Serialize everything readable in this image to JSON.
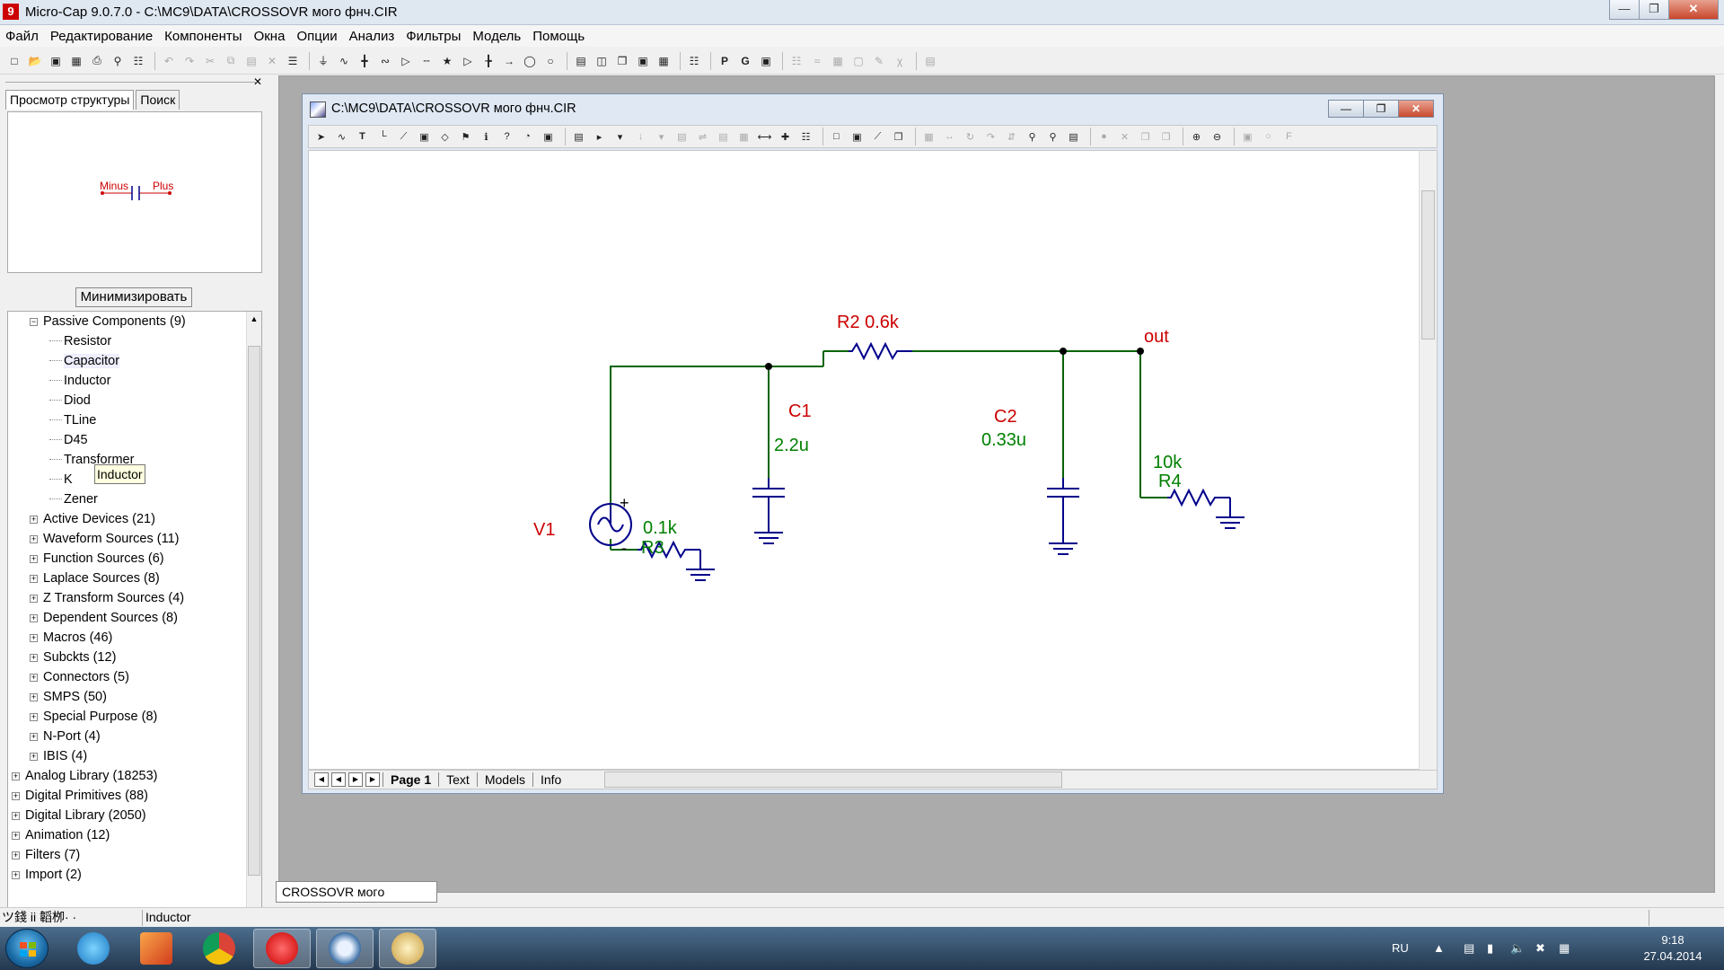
{
  "window": {
    "title": "Micro-Cap 9.0.7.0 - C:\\MC9\\DATA\\CROSSOVR могo фнч.CIR",
    "app_icon_letter": "9"
  },
  "menu": [
    "Файл",
    "Редактирование",
    "Компоненты",
    "Окна",
    "Опции",
    "Анализ",
    "Фильтры",
    "Модель",
    "Помощь"
  ],
  "left_panel": {
    "tabs": [
      "Просмотр структуры",
      "Поиск"
    ],
    "preview": {
      "minus_label": "Minus",
      "plus_label": "Plus"
    },
    "minimize_label": "Минимизировать",
    "tooltip": "Inductor",
    "tree": [
      {
        "label": "Passive Components (9)",
        "level": 1,
        "expand": "−"
      },
      {
        "label": "Resistor",
        "level": 2
      },
      {
        "label": "Capacitor",
        "level": 2
      },
      {
        "label": "Inductor",
        "level": 2
      },
      {
        "label": "Diod",
        "level": 2
      },
      {
        "label": "TLine",
        "level": 2
      },
      {
        "label": "D45",
        "level": 2
      },
      {
        "label": "Transformer",
        "level": 2
      },
      {
        "label": "K",
        "level": 2
      },
      {
        "label": "Zener",
        "level": 2
      },
      {
        "label": "Active Devices (21)",
        "level": 1,
        "expand": "+"
      },
      {
        "label": "Waveform Sources (11)",
        "level": 1,
        "expand": "+"
      },
      {
        "label": "Function Sources (6)",
        "level": 1,
        "expand": "+"
      },
      {
        "label": "Laplace Sources (8)",
        "level": 1,
        "expand": "+"
      },
      {
        "label": "Z Transform Sources (4)",
        "level": 1,
        "expand": "+"
      },
      {
        "label": "Dependent Sources (8)",
        "level": 1,
        "expand": "+"
      },
      {
        "label": "Macros (46)",
        "level": 1,
        "expand": "+"
      },
      {
        "label": "Subckts (12)",
        "level": 1,
        "expand": "+"
      },
      {
        "label": "Connectors (5)",
        "level": 1,
        "expand": "+"
      },
      {
        "label": "SMPS (50)",
        "level": 1,
        "expand": "+"
      },
      {
        "label": "Special Purpose (8)",
        "level": 1,
        "expand": "+"
      },
      {
        "label": "N-Port (4)",
        "level": 1,
        "expand": "+"
      },
      {
        "label": "IBIS (4)",
        "level": 1,
        "expand": "+"
      },
      {
        "label": "Analog Library (18253)",
        "level": 0,
        "expand": "+"
      },
      {
        "label": "Digital Primitives (88)",
        "level": 0,
        "expand": "+"
      },
      {
        "label": "Digital Library (2050)",
        "level": 0,
        "expand": "+"
      },
      {
        "label": "Animation (12)",
        "level": 0,
        "expand": "+"
      },
      {
        "label": "Filters (7)",
        "level": 0,
        "expand": "+"
      },
      {
        "label": "Import (2)",
        "level": 0,
        "expand": "+"
      }
    ]
  },
  "document": {
    "title": "C:\\MC9\\DATA\\CROSSOVR могo фнч.CIR",
    "page_tabs": [
      "Page 1",
      "Text",
      "Models",
      "Info"
    ],
    "mdi_tab": "CROSSOVR могo фнч.CIR"
  },
  "schematic": {
    "labels": {
      "r2": "R2 0.6k",
      "c1_name": "C1",
      "c1_value": "2.2u",
      "c2_name": "C2",
      "c2_value": "0.33u",
      "v1": "V1",
      "r3_value": "0.1k",
      "r3_name": "R3",
      "r4_value": "10k",
      "r4_name": "R4",
      "out": "out",
      "plus": "+",
      "minus": "-"
    },
    "colors": {
      "wire": "#006400",
      "component": "#00008b",
      "name_label": "#cc0000",
      "value_label": "#008000"
    }
  },
  "status_bar": {
    "left": "ツ錢 ii 韜栁·  ·",
    "right": "Inductor"
  },
  "taskbar": {
    "apps": [
      "start-button",
      "internet-explorer",
      "office",
      "chrome",
      "opera",
      "micro-cap",
      "paint"
    ],
    "tray": {
      "lang": "RU",
      "time": "9:18",
      "date": "27.04.2014"
    }
  }
}
